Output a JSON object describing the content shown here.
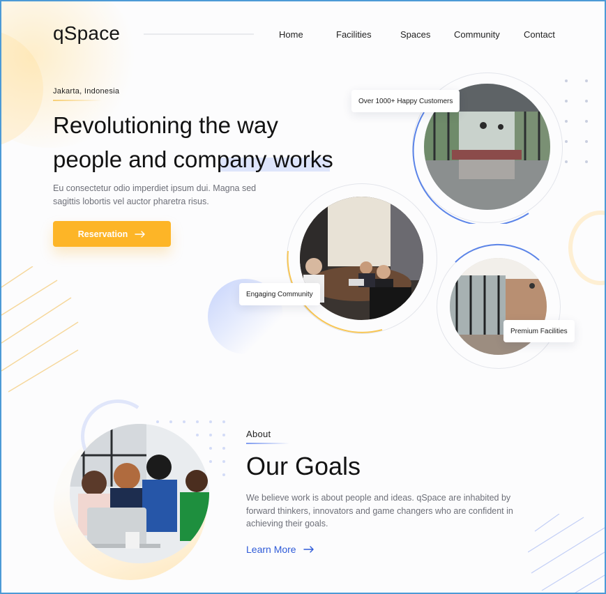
{
  "brand": {
    "logo": "qSpace"
  },
  "nav": {
    "items": [
      {
        "label": "Home"
      },
      {
        "label": "Facilities"
      },
      {
        "label": "Spaces"
      },
      {
        "label": "Community"
      },
      {
        "label": "Contact"
      }
    ]
  },
  "hero": {
    "location": "Jakarta, Indonesia",
    "headline_line1": "Revolutioning the way",
    "headline_line2": "people and company works",
    "subtext": "Eu consectetur odio imperdiet ipsum dui. Magna sed sagittis lobortis vel auctor pharetra risus.",
    "cta_label": "Reservation",
    "cta_icon": "arrow-right-icon",
    "badges": {
      "customers": "Over 1000+ Happy Customers",
      "community": "Engaging Community",
      "facilities": "Premium Facilities"
    }
  },
  "about": {
    "label": "About",
    "title": "Our Goals",
    "body": "We believe work is about people and ideas. qSpace are inhabited by forward thinkers, innovators and game changers who are confident in achieving their goals.",
    "link_label": "Learn More",
    "link_icon": "arrow-right-icon"
  },
  "colors": {
    "accent_yellow": "#fdb527",
    "accent_blue": "#2f5bd8",
    "ring_blue": "#5b84e8"
  }
}
